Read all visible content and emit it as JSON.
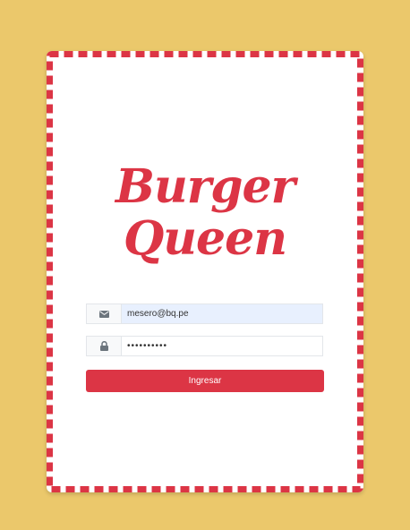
{
  "brand": {
    "line1": "Burger",
    "line2": "Queen"
  },
  "login": {
    "email_value": "mesero@bq.pe",
    "email_icon": "envelope-icon",
    "password_value": "bqpassword",
    "password_icon": "lock-icon",
    "submit_label": "Ingresar"
  },
  "colors": {
    "background": "#ebc86b",
    "accent": "#dc3545",
    "card": "#ffffff",
    "autofill": "#e8f0fe"
  }
}
